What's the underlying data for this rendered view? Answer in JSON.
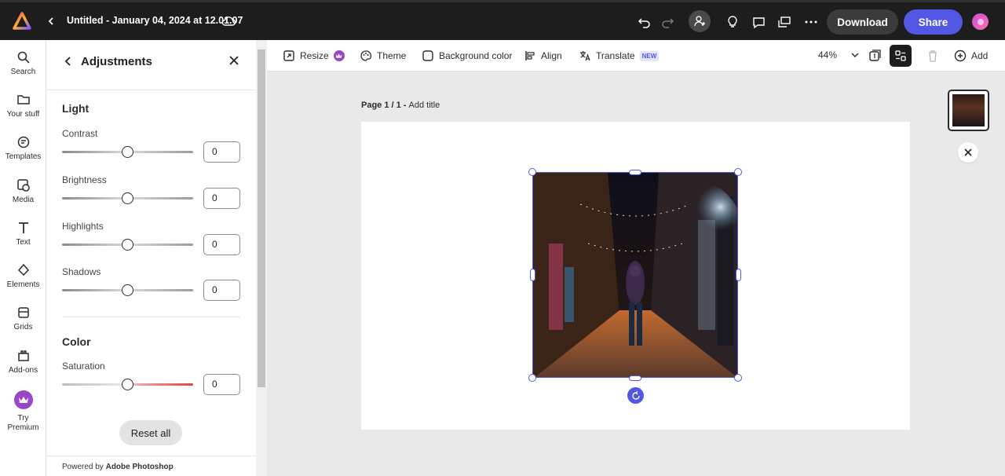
{
  "app": {
    "doc_title": "Untitled - January 04, 2024 at 12.01.07",
    "download_label": "Download",
    "share_label": "Share",
    "accent_color": "#5258e4"
  },
  "rail": {
    "items": [
      {
        "label": "Search",
        "icon": "search-icon"
      },
      {
        "label": "Your stuff",
        "icon": "folder-icon"
      },
      {
        "label": "Templates",
        "icon": "templates-icon"
      },
      {
        "label": "Media",
        "icon": "media-icon"
      },
      {
        "label": "Text",
        "icon": "text-icon"
      },
      {
        "label": "Elements",
        "icon": "elements-icon"
      },
      {
        "label": "Grids",
        "icon": "grids-icon"
      },
      {
        "label": "Add-ons",
        "icon": "addons-icon"
      },
      {
        "label": "Try Premium",
        "icon": "crown-icon"
      }
    ]
  },
  "panel": {
    "title": "Adjustments",
    "light_section": "Light",
    "color_section": "Color",
    "sliders": [
      {
        "label": "Contrast",
        "value": "0"
      },
      {
        "label": "Brightness",
        "value": "0"
      },
      {
        "label": "Highlights",
        "value": "0"
      },
      {
        "label": "Shadows",
        "value": "0"
      },
      {
        "label": "Saturation",
        "value": "0"
      }
    ],
    "reset_label": "Reset all",
    "powered_prefix": "Powered by ",
    "powered_brand": "Adobe Photoshop"
  },
  "toolbar": {
    "resize": "Resize",
    "theme": "Theme",
    "background": "Background color",
    "align": "Align",
    "translate": "Translate",
    "new_badge": "NEW",
    "zoom": "44%",
    "add": "Add"
  },
  "canvas": {
    "page_prefix": "Page 1 / 1 - ",
    "page_title_placeholder": "Add title"
  }
}
